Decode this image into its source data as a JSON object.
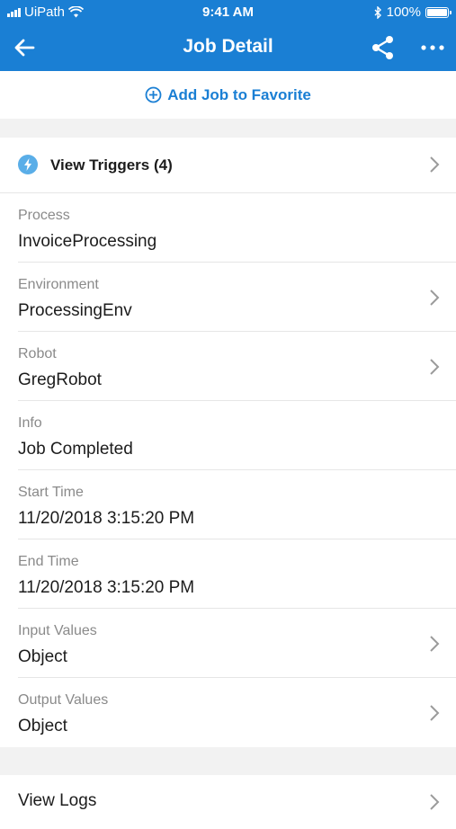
{
  "status_bar": {
    "carrier": "UiPath",
    "time": "9:41 AM",
    "battery": "100%"
  },
  "header": {
    "title": "Job Detail",
    "back_icon": "arrow-left-icon",
    "share_icon": "share-icon",
    "more_icon": "more-horizontal-icon"
  },
  "favorite": {
    "label": "Add Job to Favorite",
    "icon": "plus-circle-icon"
  },
  "triggers": {
    "label": "View Triggers (4)",
    "icon": "lightning-icon"
  },
  "details": [
    {
      "label": "Process",
      "value": "InvoiceProcessing",
      "has_chevron": false
    },
    {
      "label": "Environment",
      "value": "ProcessingEnv",
      "has_chevron": true
    },
    {
      "label": "Robot",
      "value": "GregRobot",
      "has_chevron": true
    },
    {
      "label": "Info",
      "value": "Job Completed",
      "has_chevron": false
    },
    {
      "label": "Start Time",
      "value": "11/20/2018 3:15:20 PM",
      "has_chevron": false
    },
    {
      "label": "End Time",
      "value": "11/20/2018 3:15:20 PM",
      "has_chevron": false
    },
    {
      "label": "Input Values",
      "value": "Object",
      "has_chevron": true
    },
    {
      "label": "Output Values",
      "value": "Object",
      "has_chevron": true
    }
  ],
  "logs": {
    "label": "View Logs"
  },
  "colors": {
    "primary": "#1a7fd4",
    "background": "#f2f2f2",
    "label_gray": "#8a8a8a",
    "trigger_icon": "#5aaee8"
  }
}
